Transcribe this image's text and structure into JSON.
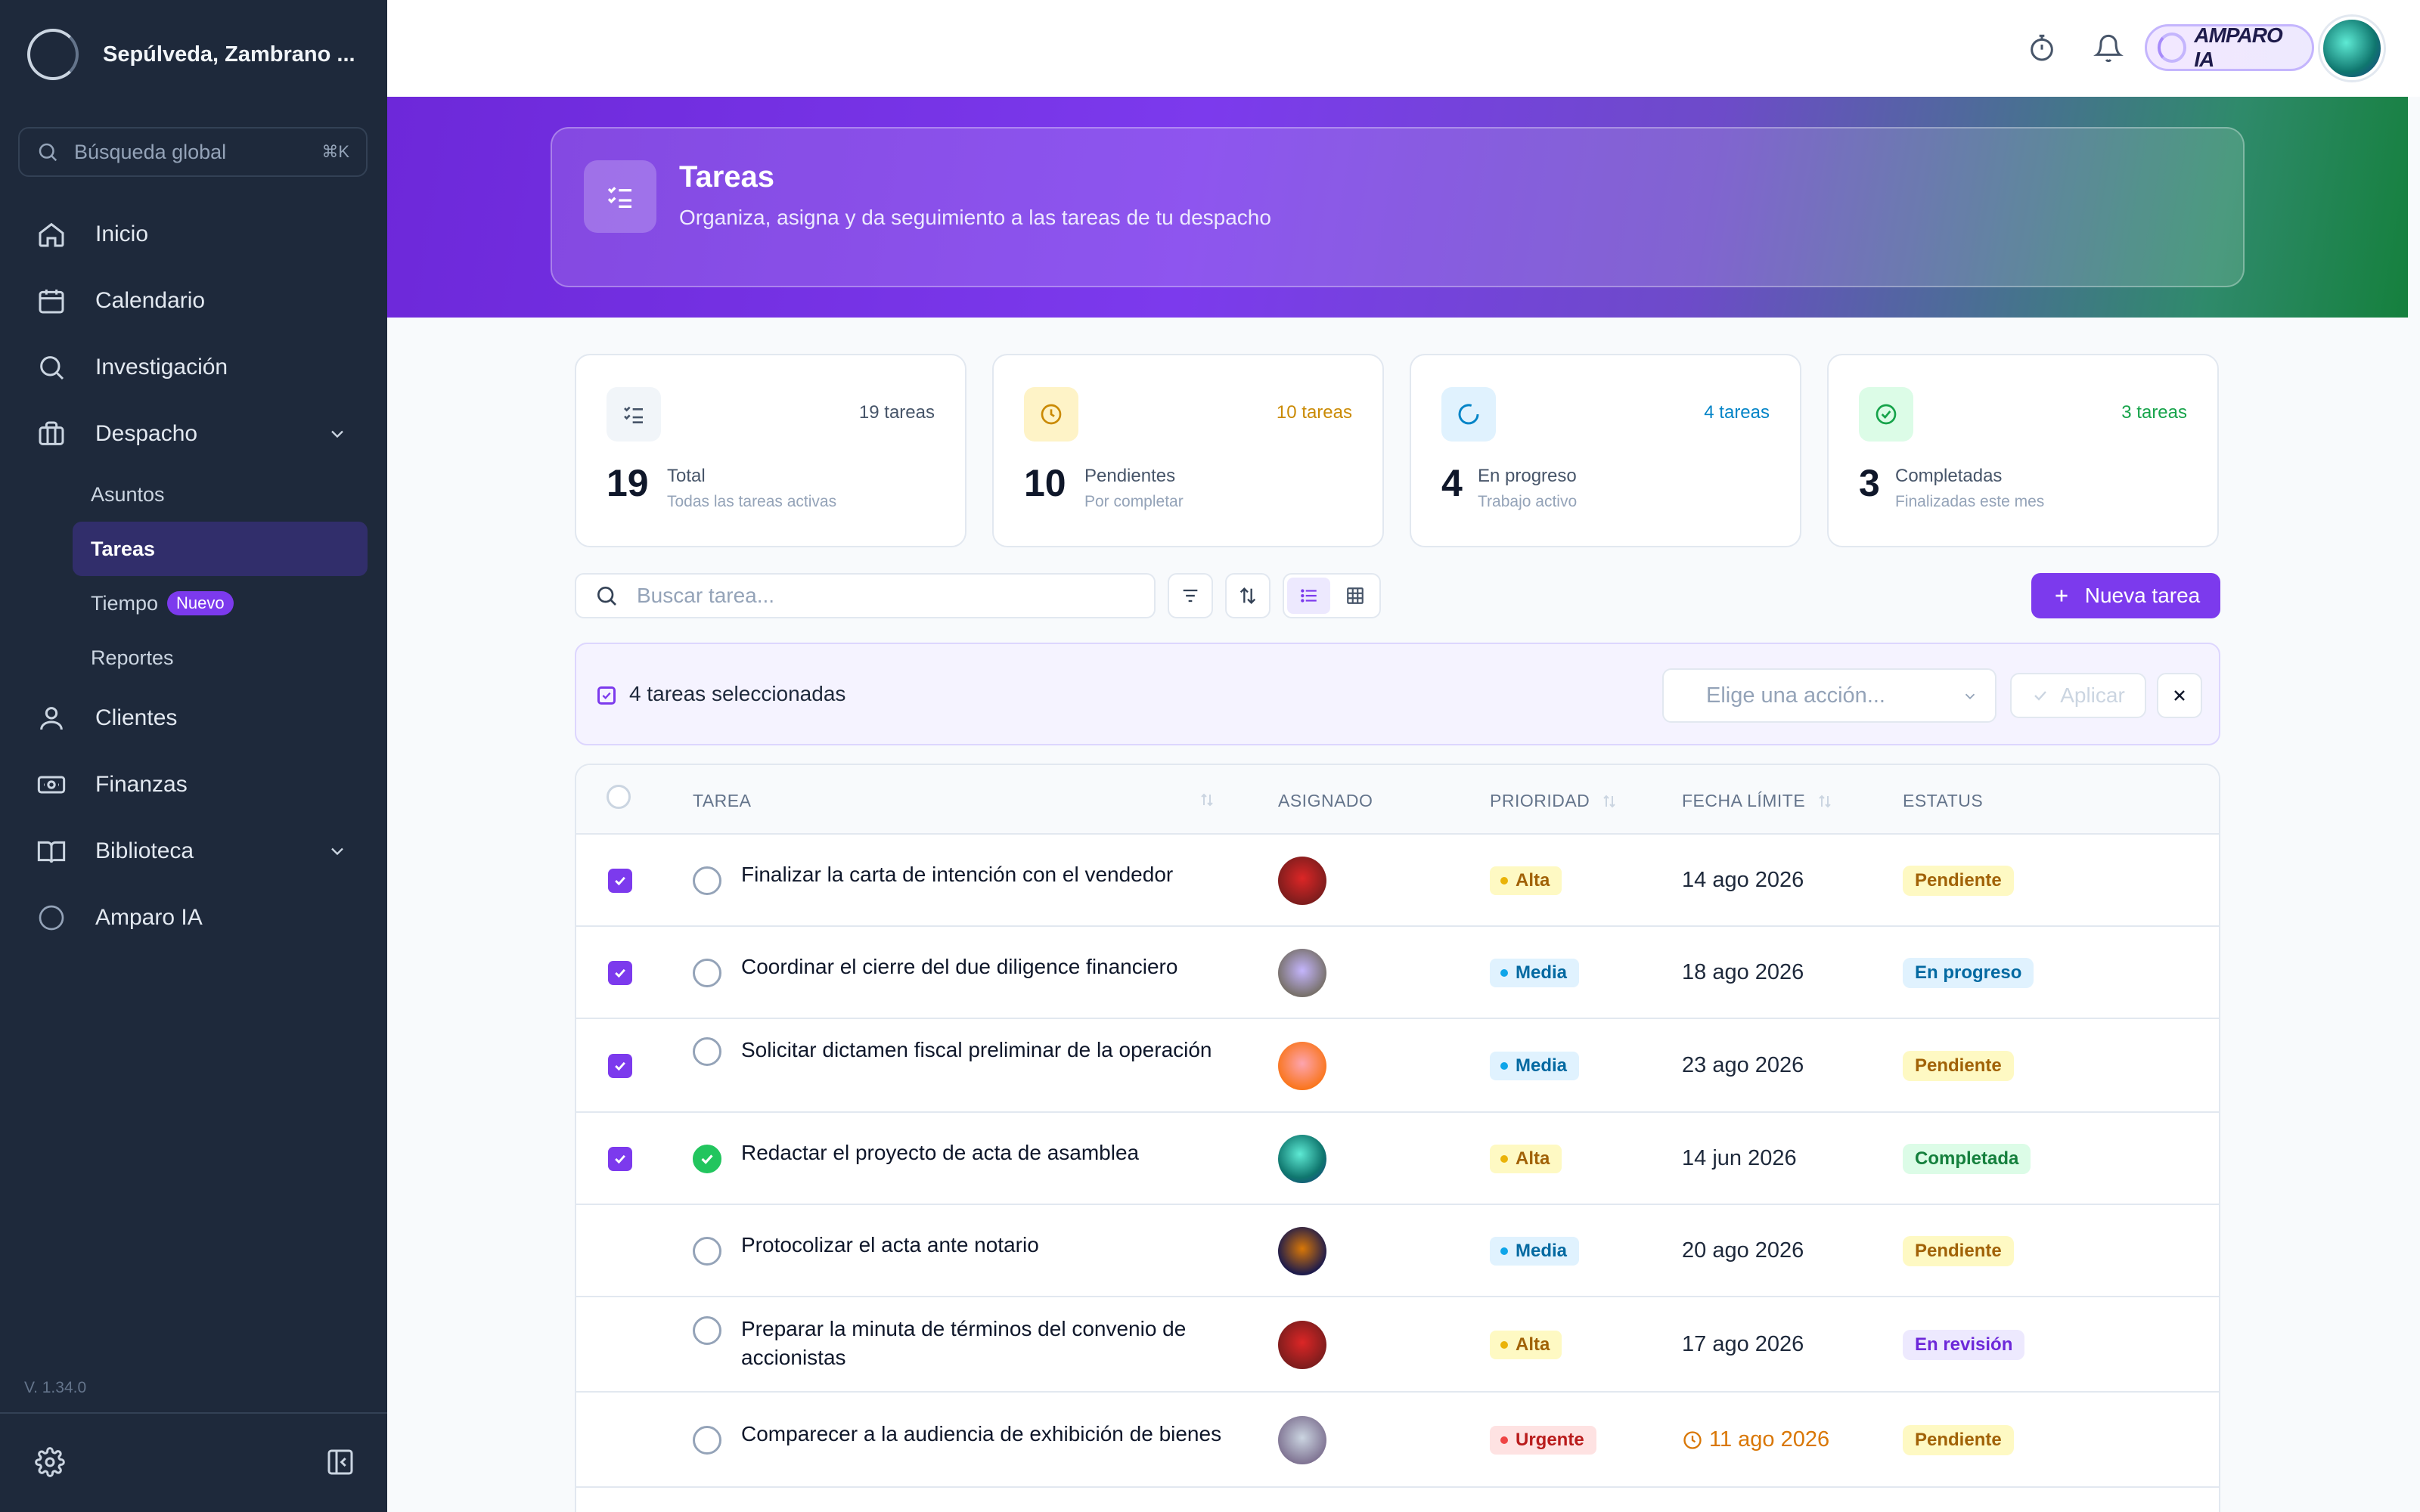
{
  "sidebar": {
    "firm_name": "Sepúlveda, Zambrano ...",
    "search_label": "Búsqueda global",
    "search_shortcut": "⌘K",
    "nav": {
      "inicio": "Inicio",
      "calendario": "Calendario",
      "investigacion": "Investigación",
      "despacho": "Despacho",
      "clientes": "Clientes",
      "finanzas": "Finanzas",
      "biblioteca": "Biblioteca",
      "amparo": "Amparo IA"
    },
    "despacho_sub": {
      "asuntos": "Asuntos",
      "tareas": "Tareas",
      "tiempo": "Tiempo",
      "tiempo_badge": "Nuevo",
      "reportes": "Reportes"
    },
    "version": "V. 1.34.0"
  },
  "topbar": {
    "ai_label": "AMPARO IA"
  },
  "hero": {
    "title": "Tareas",
    "subtitle": "Organiza, asigna y da seguimiento a las tareas de tu despacho"
  },
  "stats": [
    {
      "count_label": "19 tareas",
      "number": "19",
      "label": "Total",
      "desc": "Todas las tareas activas",
      "color": "#475569",
      "bg": "#f1f5f9"
    },
    {
      "count_label": "10 tareas",
      "number": "10",
      "label": "Pendientes",
      "desc": "Por completar",
      "color": "#ca8a04",
      "bg": "#fef3c7"
    },
    {
      "count_label": "4 tareas",
      "number": "4",
      "label": "En progreso",
      "desc": "Trabajo activo",
      "color": "#0284c7",
      "bg": "#e0f2fe"
    },
    {
      "count_label": "3 tareas",
      "number": "3",
      "label": "Completadas",
      "desc": "Finalizadas este mes",
      "color": "#16a34a",
      "bg": "#dcfce7"
    }
  ],
  "toolbar": {
    "search_placeholder": "Buscar tarea...",
    "new_task": "Nueva tarea"
  },
  "bulk": {
    "selected": "4 tareas seleccionadas",
    "action_placeholder": "Elige una acción...",
    "apply": "Aplicar"
  },
  "table": {
    "headers": {
      "tarea": "TAREA",
      "asignado": "ASIGNADO",
      "prioridad": "PRIORIDAD",
      "fecha": "FECHA LÍMITE",
      "estatus": "ESTATUS"
    },
    "rows": [
      {
        "title": "Finalizar la carta de intención con el vendedor",
        "selected": true,
        "done": false,
        "avatar": "bull",
        "priority": "Alta",
        "date": "14 ago 2026",
        "overdue": false,
        "status": "Pendiente"
      },
      {
        "title": "Coordinar el cierre del due diligence financiero",
        "selected": true,
        "done": false,
        "avatar": "owl",
        "priority": "Media",
        "date": "18 ago 2026",
        "overdue": false,
        "status": "En progreso"
      },
      {
        "title": "Solicitar dictamen fiscal preliminar de la operación",
        "selected": true,
        "done": false,
        "avatar": "flamingo",
        "priority": "Media",
        "date": "23 ago 2026",
        "overdue": false,
        "status": "Pendiente"
      },
      {
        "title": "Redactar el proyecto de acta de asamblea",
        "selected": true,
        "done": true,
        "avatar": "turtle",
        "priority": "Alta",
        "date": "14 jun 2026",
        "overdue": false,
        "status": "Completada"
      },
      {
        "title": "Protocolizar el acta ante notario",
        "selected": false,
        "done": false,
        "avatar": "lion",
        "priority": "Media",
        "date": "20 ago 2026",
        "overdue": false,
        "status": "Pendiente"
      },
      {
        "title": "Preparar la minuta de términos del convenio de accionistas",
        "selected": false,
        "done": false,
        "avatar": "bull",
        "priority": "Alta",
        "date": "17 ago 2026",
        "overdue": false,
        "status": "En revisión"
      },
      {
        "title": "Comparecer a la audiencia de exhibición de bienes",
        "selected": false,
        "done": false,
        "avatar": "cat",
        "priority": "Urgente",
        "date": "11 ago 2026",
        "overdue": true,
        "status": "Pendiente"
      }
    ]
  },
  "colors": {
    "accent": "#7c3aed",
    "sidebar_bg": "#1e293b"
  }
}
